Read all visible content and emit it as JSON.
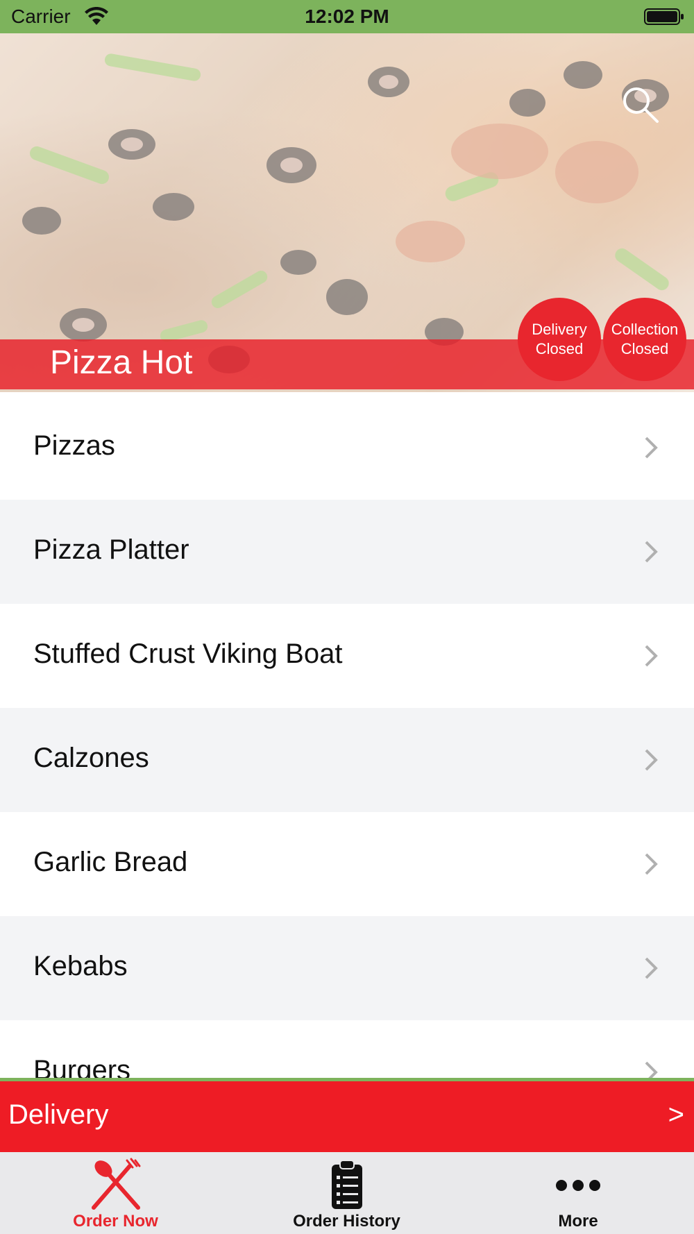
{
  "status_bar": {
    "carrier": "Carrier",
    "time": "12:02 PM"
  },
  "header": {
    "store_name": "Pizza Hot",
    "delivery_status": [
      "Delivery",
      "Closed"
    ],
    "collection_status": [
      "Collection",
      "Closed"
    ]
  },
  "menu": {
    "categories": [
      {
        "label": "Pizzas"
      },
      {
        "label": "Pizza Platter"
      },
      {
        "label": "Stuffed Crust Viking Boat"
      },
      {
        "label": "Calzones"
      },
      {
        "label": "Garlic Bread"
      },
      {
        "label": "Kebabs"
      },
      {
        "label": "Burgers"
      }
    ]
  },
  "order_mode": {
    "label": "Delivery",
    "arrow": ">"
  },
  "tabs": [
    {
      "label": "Order Now",
      "icon": "fork-knife-icon",
      "active": true
    },
    {
      "label": "Order History",
      "icon": "clipboard-icon",
      "active": false
    },
    {
      "label": "More",
      "icon": "more-dots-icon",
      "active": false
    }
  ],
  "colors": {
    "accent_red": "#ee1c25",
    "status_green": "#7db35c",
    "row_alt": "#f3f4f6",
    "tab_bar": "#e9e9eb"
  }
}
